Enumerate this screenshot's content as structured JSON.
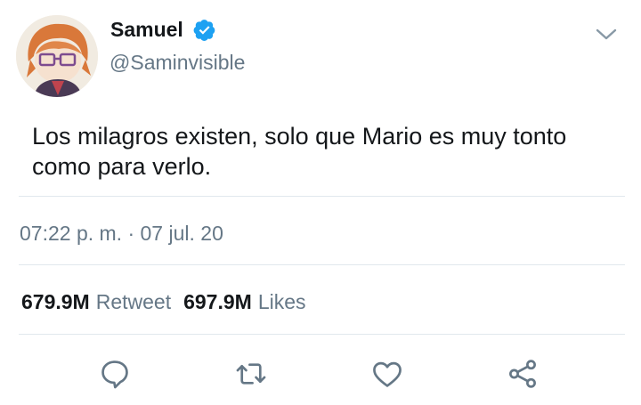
{
  "author": {
    "display_name": "Samuel",
    "handle": "@Saminvisible",
    "verified": true
  },
  "tweet": {
    "text": "Los milagros existen, solo que Mario es muy tonto como para verlo.",
    "timestamp": "07:22 p. m. · 07 jul. 20"
  },
  "stats": {
    "retweets_count": "679.9M",
    "retweets_label": "Retweet",
    "likes_count": "697.9M",
    "likes_label": "Likes"
  },
  "icons": {
    "verified": "verified-badge-icon",
    "menu": "chevron-down-icon",
    "reply": "reply-icon",
    "retweet": "retweet-icon",
    "like": "heart-icon",
    "share": "share-icon"
  },
  "colors": {
    "verified_blue": "#1da1f2",
    "secondary_text": "#657786",
    "icon_gray": "#657786",
    "divider": "#e1e8ed"
  }
}
